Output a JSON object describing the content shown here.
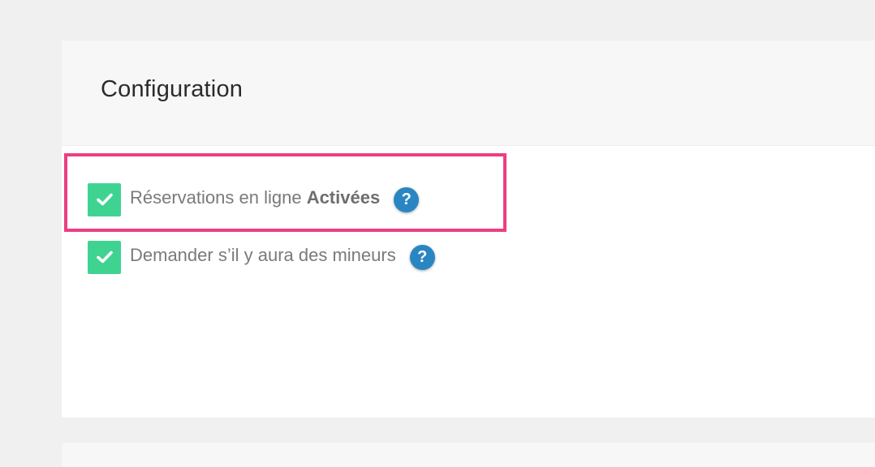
{
  "config": {
    "title": "Configuration",
    "options": [
      {
        "label_prefix": "Réservations en ligne ",
        "label_strong": "Activées",
        "checked": true,
        "help": "?"
      },
      {
        "label_prefix": "Demander s’il y aura des mineurs",
        "label_strong": "",
        "checked": true,
        "help": "?"
      }
    ]
  },
  "colors": {
    "checkbox": "#3fd392",
    "help": "#2a86c2",
    "highlight": "#ee3d84"
  },
  "icons": {
    "checkbox": "checkmark-icon",
    "help": "question-icon"
  }
}
